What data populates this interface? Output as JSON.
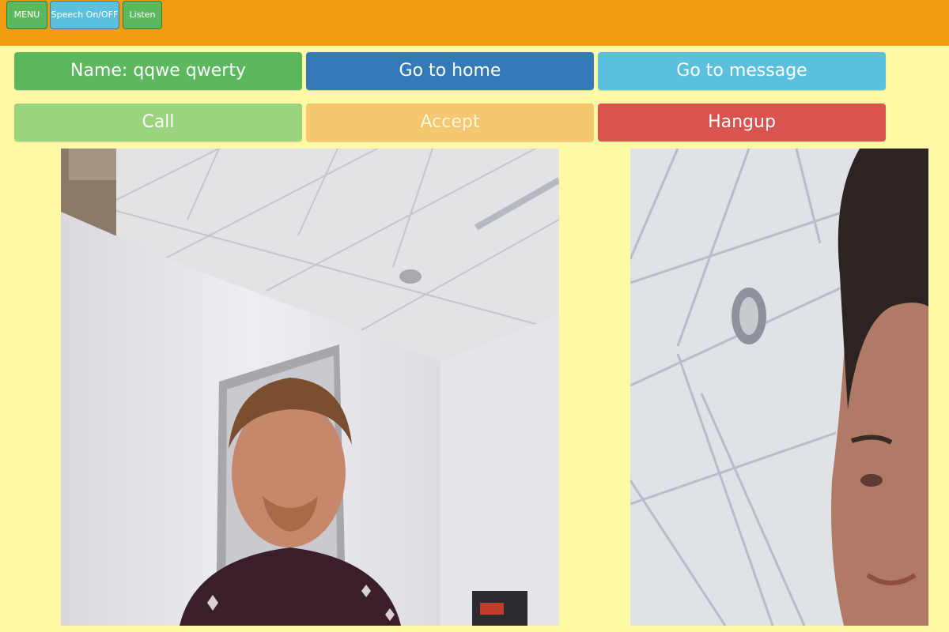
{
  "topbar": {
    "menu_label": "MENU",
    "speech_label": "Speech On/OFF",
    "listen_label": "Listen"
  },
  "controls": {
    "name_label": "Name: qqwe qwerty",
    "home_label": "Go to home",
    "message_label": "Go to message",
    "call_label": "Call",
    "accept_label": "Accept",
    "hangup_label": "Hangup"
  },
  "colors": {
    "topbar": "#f09d12",
    "background": "#fff9a6",
    "success": "#5cb85c",
    "primary": "#337ab7",
    "info": "#5bc0de",
    "warning": "#f5c76e",
    "danger": "#d9534f"
  },
  "videos": {
    "local": "local-video-feed",
    "remote": "remote-video-feed"
  }
}
